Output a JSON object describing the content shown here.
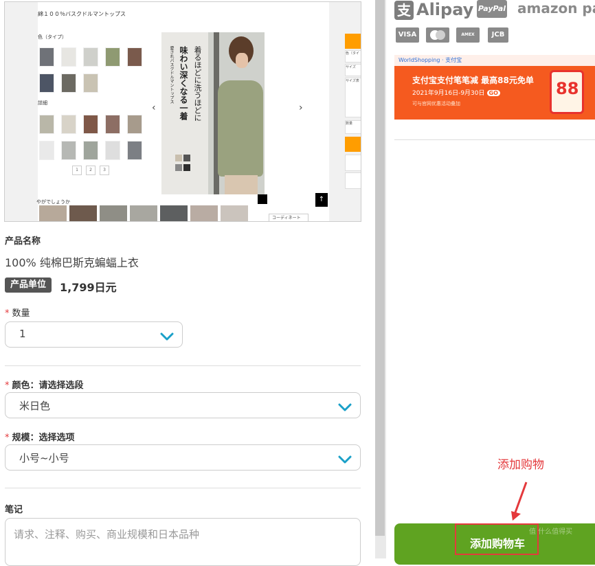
{
  "product_image": {
    "title": "綿１００％バスクドルマントップス",
    "section_color": "色（タイプ）",
    "section_detail": "詳細",
    "pager": [
      "1",
      "2",
      "3"
    ],
    "hero_text_main": "着るほどに洗うほどに",
    "hero_text_big": "味わい深くなる一着",
    "hero_text_small": "愛されバスクドルマントップス",
    "coord_label": "コーディネート",
    "strip_label": "やがでしょうか",
    "side_labels": [
      "色（タイ",
      "サイズ",
      "サイズ表",
      "数量"
    ],
    "up_arrow": "↑"
  },
  "product": {
    "name_label": "产品名称",
    "name": "100% 纯棉巴斯克蝙蝠上衣",
    "unit_badge": "产品单位",
    "price": "1,799日元"
  },
  "quantity": {
    "label": "数量",
    "value": "1"
  },
  "color": {
    "label": "颜色：请选择选段",
    "value": "米日色"
  },
  "size": {
    "label": "规模：选择选项",
    "value": "小号~小号"
  },
  "notes": {
    "label": "笔记",
    "placeholder": "请求、注释、购买、商业规模和日本品种"
  },
  "payment": {
    "alipay": "Alipay",
    "alipay_glyph": "支",
    "paypal": "PayPal",
    "amazon": "amazon pay",
    "cards": [
      "VISA",
      "MC",
      "AMEX",
      "JCB"
    ]
  },
  "banner": {
    "logo": "WorldShopping · 支付宝",
    "line1": "支付宝支付笔笔减 最高88元免单",
    "line2": "2021年9月16日-9月30日",
    "go": "GO",
    "line3": "可与官网优惠活动叠加",
    "badge": "88"
  },
  "annotation": "添加购物",
  "cart_button": "添加购物车",
  "watermark": "值 什么值得买",
  "colors": {
    "accent_green": "#5fa321",
    "required_red": "#e4393c",
    "chevron_blue": "#1aa0c8",
    "banner_orange": "#f55a1f"
  }
}
